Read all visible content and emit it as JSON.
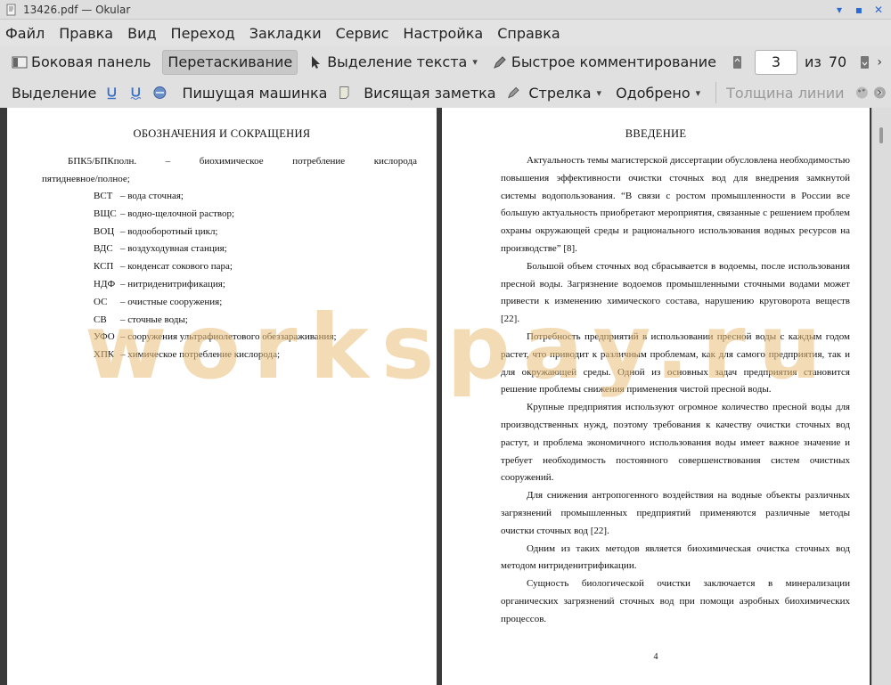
{
  "window": {
    "title": "13426.pdf — Okular"
  },
  "menubar": [
    "Файл",
    "Правка",
    "Вид",
    "Переход",
    "Закладки",
    "Сервис",
    "Настройка",
    "Справка"
  ],
  "toolbar1": {
    "sidebar": "Боковая панель",
    "browse": "Перетаскивание",
    "text_select": "Выделение текста",
    "quick_annotations": "Быстрое комментирование",
    "page_current": "3",
    "page_of": "из",
    "page_total": "70"
  },
  "toolbar2": {
    "highlight": "Выделение",
    "typewriter": "Пишущая машинка",
    "popup_note": "Висящая заметка",
    "arrow": "Стрелка",
    "stamp": "Одобрено",
    "line_width": "Толщина линии"
  },
  "left_page": {
    "heading": "ОБОЗНАЧЕНИЯ И СОКРАЩЕНИЯ",
    "first_abbr": "БПК5/БПКполн.",
    "first_dash": "–",
    "first_def_words": [
      "биохимическое",
      "потребление",
      "кислорода"
    ],
    "first_def_cont": "пятидневное/полное;",
    "items": [
      {
        "abbr": "ВСТ",
        "def": "– вода сточная;"
      },
      {
        "abbr": "ВЩС",
        "def": "– водно-щелочной раствор;"
      },
      {
        "abbr": "ВОЦ",
        "def": "– водооборотный цикл;"
      },
      {
        "abbr": "ВДС",
        "def": "– воздуходувная станция;"
      },
      {
        "abbr": "КСП",
        "def": "– конденсат сокового пара;"
      },
      {
        "abbr": "НДФ",
        "def": "– нитриденитрификация;"
      },
      {
        "abbr": "ОС",
        "def": "– очистные сооружения;"
      },
      {
        "abbr": "СВ",
        "def": "– сточные воды;"
      },
      {
        "abbr": "УФО",
        "def": "– сооружения ультрафиолетового обеззараживания;"
      },
      {
        "abbr": "ХПК",
        "def": "– химическое потребление кислорода;"
      }
    ]
  },
  "right_page": {
    "heading": "ВВЕДЕНИЕ",
    "paragraphs": [
      "Актуальность темы магистерской диссертации обусловлена необходимостью повышения эффективности очистки сточных вод для внедрения замкнутой системы водопользования. “В связи с ростом промышленности в России все большую актуальность приобретают мероприятия, связанные с решением проблем охраны окружающей среды и рационального использования водных ресурсов на производстве” [8].",
      "Большой объем сточных вод сбрасывается в водоемы, после использования пресной воды. Загрязнение водоемов промышленными сточными водами может привести к изменению химического состава, нарушению круговорота веществ [22].",
      "Потребность предприятий в использовании пресной воды с каждым годом растет, что приводит к различным проблемам, как для самого предприятия, так и для окружающей среды. Одной из основных задач предприятия становится решение проблемы снижения применения чистой пресной воды.",
      "Крупные предприятия используют огромное количество пресной воды для производственных нужд, поэтому требования к качеству очистки сточных вод растут, и проблема экономичного использования воды имеет важное значение и требует необходимость постоянного совершенствования систем очистных сооружений.",
      "Для снижения антропогенного воздействия на водные объекты различных загрязнений промышленных предприятий применяются различные методы очистки сточных вод [22].",
      "Одним из таких методов является биохимическая очистка сточных вод методом нитриденитрификации.",
      "Сущность биологической очистки заключается в минерализации органических загрязнений сточных вод при помощи аэробных биохимических процессов."
    ],
    "page_number": "4"
  },
  "watermark": "workspay.ru",
  "colors": {
    "accent": "#2a6ad6",
    "watermark": "#e9be78"
  }
}
